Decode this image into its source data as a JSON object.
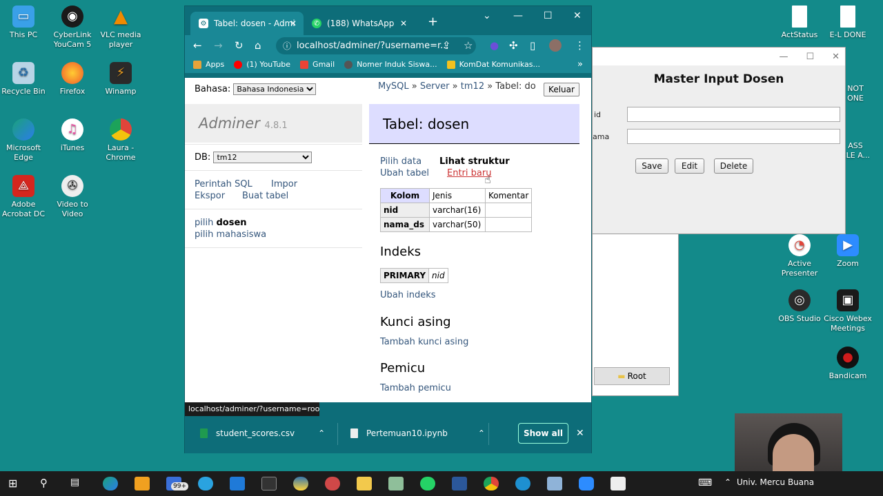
{
  "desktop": {
    "left_icons": [
      {
        "label": "This PC",
        "icon": "computer-icon",
        "color": "#3aa0e8"
      },
      {
        "label": "CyberLink YouCam 5",
        "icon": "webcam-icon",
        "color": "#1a1a1a"
      },
      {
        "label": "VLC media player",
        "icon": "vlc-cone-icon",
        "color": "#f08a00"
      },
      {
        "label": "Recycle Bin",
        "icon": "recycle-bin-icon",
        "color": "#b8d4e6"
      },
      {
        "label": "Firefox",
        "icon": "firefox-icon",
        "color": "#f0582a"
      },
      {
        "label": "Winamp",
        "icon": "winamp-icon",
        "color": "#2a2a2a"
      },
      {
        "label": "Microsoft Edge",
        "icon": "edge-icon",
        "color": "#1aa17c"
      },
      {
        "label": "iTunes",
        "icon": "itunes-icon",
        "color": "#e84fa0"
      },
      {
        "label": "Laura - Chrome",
        "icon": "chrome-icon",
        "color": "#e0453a"
      },
      {
        "label": "Adobe Acrobat DC",
        "icon": "acrobat-icon",
        "color": "#d4261e"
      },
      {
        "label": "Video to Video",
        "icon": "film-reel-icon",
        "color": "#3a3a3a"
      }
    ],
    "right_icons": [
      {
        "label": "ActStatus",
        "icon": "document-icon",
        "color": "#ffffff"
      },
      {
        "label": "E-L DONE",
        "icon": "document-icon",
        "color": "#ffffff"
      },
      {
        "label": "Active Presenter",
        "icon": "active-presenter-icon",
        "color": "#e0e0e0"
      },
      {
        "label": "Zoom",
        "icon": "zoom-icon",
        "color": "#2d8cff"
      },
      {
        "label": "OBS Studio",
        "icon": "obs-icon",
        "color": "#2a2a2a"
      },
      {
        "label": "Cisco Webex Meetings",
        "icon": "webex-icon",
        "color": "#1a1a1a"
      },
      {
        "label": "Bandicam",
        "icon": "bandicam-icon",
        "color": "#d01c1c"
      }
    ],
    "partial_labels": [
      "NOT",
      "ONE",
      "ASS",
      "CLE A..."
    ]
  },
  "java_window": {
    "title": "Master Input Dosen",
    "field1_label": "id",
    "field2_label": "ama",
    "buttons": [
      "Save",
      "Edit",
      "Delete"
    ],
    "window_controls": [
      "—",
      "☐",
      "✕"
    ]
  },
  "white_window": {
    "root_button": "Root"
  },
  "browser": {
    "tabs": [
      {
        "title": "Tabel: dosen - Admi",
        "close": "✕"
      },
      {
        "title": "(188) WhatsApp",
        "close": "✕"
      }
    ],
    "new_tab": "+",
    "window_controls": [
      "⌄",
      "—",
      "☐",
      "✕"
    ],
    "url": "localhost/adminer/?username=r...",
    "bookmarks": [
      {
        "label": "Apps",
        "color": "#e8a33a"
      },
      {
        "label": "(1) YouTube",
        "color": "#ff0000"
      },
      {
        "label": "Gmail",
        "color": "#ea4335"
      },
      {
        "label": "Nomer Induk Siswa...",
        "color": "#555555"
      },
      {
        "label": "KomDat Komunikas...",
        "color": "#f2c11e"
      }
    ],
    "bookmarks_more": "»",
    "status_url": "localhost/adminer/?username=root...",
    "downloads": [
      {
        "name": "student_scores.csv"
      },
      {
        "name": "Pertemuan10.ipynb"
      }
    ],
    "show_all": "Show all"
  },
  "adminer": {
    "bahasa_label": "Bahasa:",
    "bahasa_value": "Bahasa Indonesia",
    "breadcrumb": {
      "mysql": "MySQL",
      "sep": "»",
      "server": "Server",
      "db": "tm12",
      "current": "Tabel: do"
    },
    "logout": "Keluar",
    "brand": "Adminer",
    "version": "4.8.1",
    "db_label": "DB:",
    "db_value": "tm12",
    "links": {
      "sql": "Perintah SQL",
      "import": "Impor",
      "export": "Ekspor",
      "create_table": "Buat tabel"
    },
    "tables": [
      {
        "prefix": "pilih",
        "name": "dosen"
      },
      {
        "prefix": "pilih",
        "name": "mahasiswa"
      }
    ],
    "page_title": "Tabel: dosen",
    "actions": {
      "select": "Pilih data",
      "structure": "Lihat struktur",
      "alter": "Ubah tabel",
      "new_item": "Entri baru"
    },
    "structure": {
      "headers": [
        "Kolom",
        "Jenis",
        "Komentar"
      ],
      "rows": [
        {
          "column": "nid",
          "type": "varchar(16)",
          "comment": ""
        },
        {
          "column": "nama_ds",
          "type": "varchar(50)",
          "comment": ""
        }
      ]
    },
    "indexes_title": "Indeks",
    "index": {
      "type": "PRIMARY",
      "column": "nid"
    },
    "alter_indexes": "Ubah indeks",
    "fk_title": "Kunci asing",
    "add_fk": "Tambah kunci asing",
    "triggers_title": "Pemicu",
    "add_trigger": "Tambah pemicu"
  },
  "taskbar": {
    "badge": "99+",
    "tray_text": "Univ. Mercu Buana"
  }
}
